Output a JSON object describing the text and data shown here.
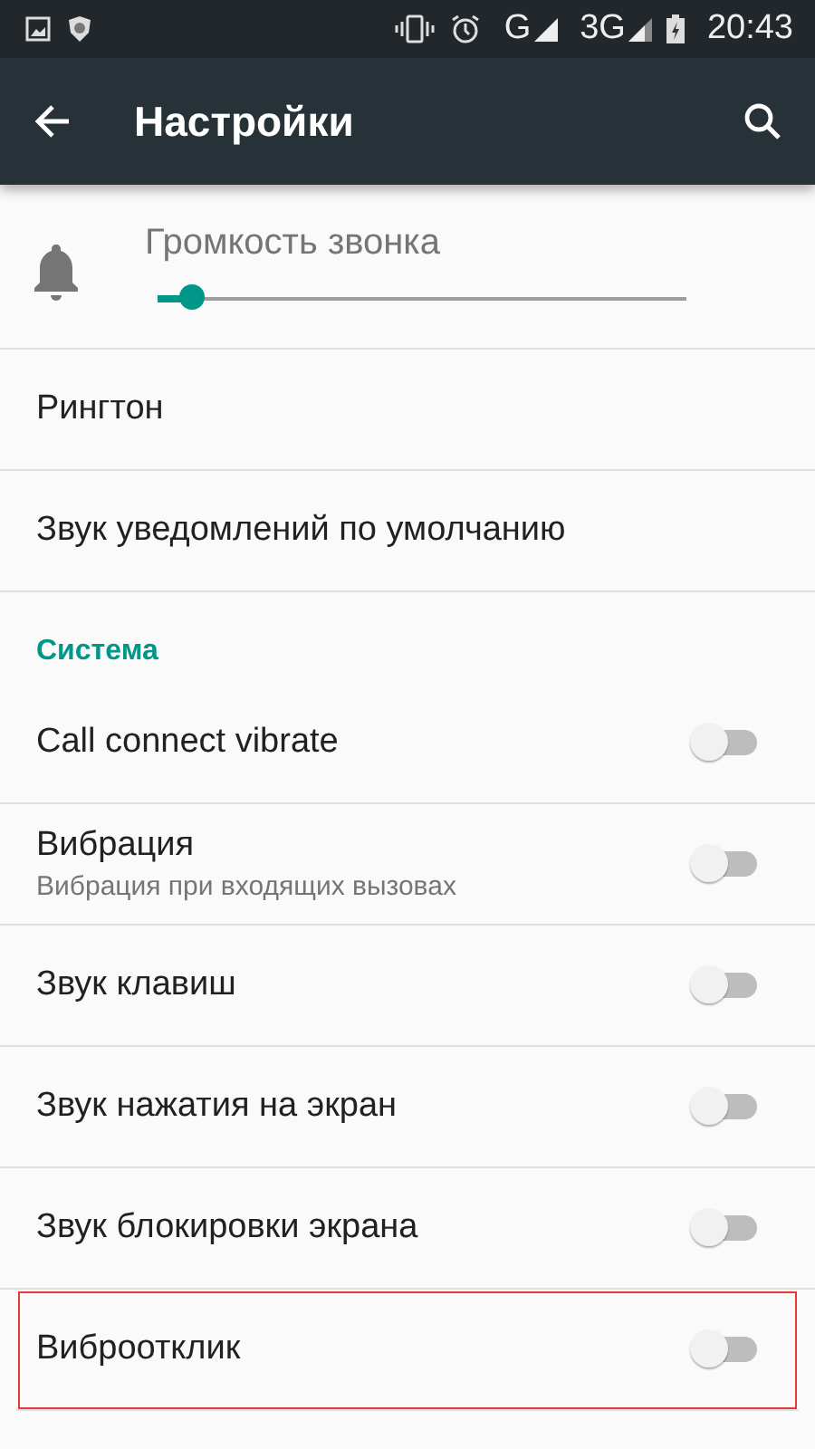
{
  "status_bar": {
    "network_1": "G",
    "network_2": "3G",
    "time": "20:43"
  },
  "toolbar": {
    "title": "Настройки"
  },
  "volume": {
    "label": "Громкость звонка",
    "level": 0.065
  },
  "items": [
    {
      "kind": "plain",
      "title": "Рингтон"
    },
    {
      "kind": "plain",
      "title": "Звук уведомлений по умолчанию"
    },
    {
      "kind": "header",
      "title": "Система"
    },
    {
      "kind": "switch",
      "title": "Call connect vibrate",
      "on": false,
      "highlighted": false
    },
    {
      "kind": "switch",
      "title": "Вибрация",
      "subtitle": "Вибрация при входящих вызовах",
      "on": false,
      "highlighted": false
    },
    {
      "kind": "switch",
      "title": "Звук клавиш",
      "on": false,
      "highlighted": false
    },
    {
      "kind": "switch",
      "title": "Звук нажатия на экран",
      "on": false,
      "highlighted": false
    },
    {
      "kind": "switch",
      "title": "Звук блокировки экрана",
      "on": false,
      "highlighted": false
    },
    {
      "kind": "switch",
      "title": "Виброотклик",
      "on": false,
      "highlighted": true
    }
  ]
}
